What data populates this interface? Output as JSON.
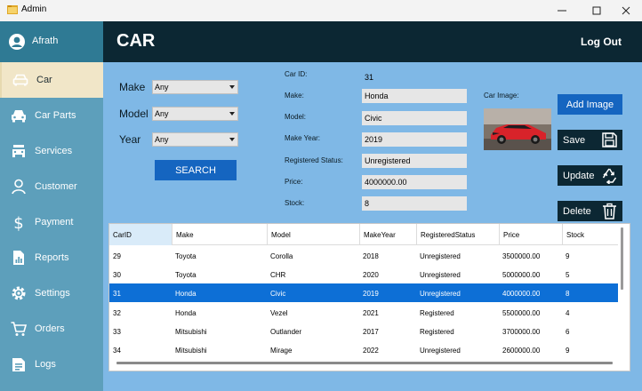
{
  "window": {
    "title": "Admin",
    "minimize": "—",
    "maximize": "☐",
    "close": "✕"
  },
  "user": {
    "name": "Afrath"
  },
  "nav": [
    {
      "label": "Car",
      "icon": "car-icon",
      "active": true
    },
    {
      "label": "Car Parts",
      "icon": "car-parts-icon",
      "active": false
    },
    {
      "label": "Services",
      "icon": "services-icon",
      "active": false
    },
    {
      "label": "Customer",
      "icon": "customer-icon",
      "active": false
    },
    {
      "label": "Payment",
      "icon": "dollar-icon",
      "active": false
    },
    {
      "label": "Reports",
      "icon": "reports-icon",
      "active": false
    },
    {
      "label": "Settings",
      "icon": "gear-icon",
      "active": false
    },
    {
      "label": "Orders",
      "icon": "cart-icon",
      "active": false
    },
    {
      "label": "Logs",
      "icon": "logs-icon",
      "active": false
    }
  ],
  "header": {
    "title": "CAR",
    "logout": "Log Out"
  },
  "filters": {
    "make_label": "Make",
    "make_value": "Any",
    "model_label": "Model",
    "model_value": "Any",
    "year_label": "Year",
    "year_value": "Any",
    "search_button": "SEARCH"
  },
  "details": {
    "car_id_label": "Car ID:",
    "car_id": "31",
    "make_label": "Make:",
    "make": "Honda",
    "model_label": "Model:",
    "model": "Civic",
    "make_year_label": "Make Year:",
    "make_year": "2019",
    "status_label": "Registered Status:",
    "status": "Unregistered",
    "price_label": "Price:",
    "price": "4000000.00",
    "stock_label": "Stock:",
    "stock": "8",
    "image_label": "Car Image:"
  },
  "actions": {
    "add_image": "Add Image",
    "save": "Save",
    "update": "Update",
    "delete": "Delete"
  },
  "table": {
    "columns": [
      "CarID",
      "Make",
      "Model",
      "MakeYear",
      "RegisteredStatus",
      "Price",
      "Stock"
    ],
    "rows": [
      [
        "29",
        "Toyota",
        "Corolla",
        "2018",
        "Unregistered",
        "3500000.00",
        "9"
      ],
      [
        "30",
        "Toyota",
        "CHR",
        "2020",
        "Unregistered",
        "5000000.00",
        "5"
      ],
      [
        "31",
        "Honda",
        "Civic",
        "2019",
        "Unregistered",
        "4000000.00",
        "8"
      ],
      [
        "32",
        "Honda",
        "Vezel",
        "2021",
        "Registered",
        "5500000.00",
        "4"
      ],
      [
        "33",
        "Mitsubishi",
        "Outlander",
        "2017",
        "Registered",
        "3700000.00",
        "6"
      ],
      [
        "34",
        "Mitsubishi",
        "Mirage",
        "2022",
        "Unregistered",
        "2600000.00",
        "9"
      ]
    ],
    "selected_index": 2
  },
  "colors": {
    "sidebar": "#5d9fbb",
    "header": "#0c2733",
    "content": "#7fb8e6",
    "button_blue": "#1565c0",
    "button_dark": "#0c2733",
    "selected_row": "#0d6fd6"
  }
}
